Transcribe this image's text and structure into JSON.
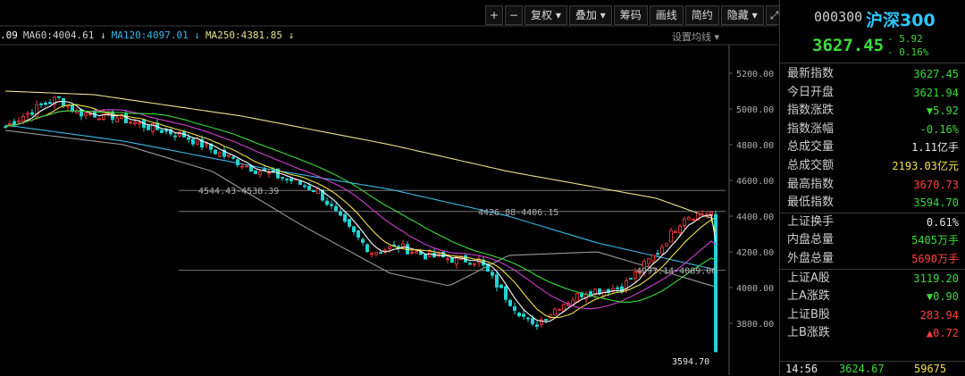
{
  "toolbar": {
    "plus": "+",
    "minus": "−",
    "fuquan": "复权",
    "diejia": "叠加",
    "chouma": "筹码",
    "huaxian": "画线",
    "jianyue": "简约",
    "yincang": "隐藏",
    "expand": "⤢"
  },
  "ma_legend": [
    {
      "text": ".09",
      "color": "#ffffff"
    },
    {
      "text": "MA60:4004.61 ↓",
      "color": "#cfcfcf"
    },
    {
      "text": "MA120:4097.01 ↓",
      "color": "#3ab8e8"
    },
    {
      "text": "MA250:4381.85 ↓",
      "color": "#e8e08a"
    }
  ],
  "settings_label": "设置均线 ▾",
  "chart_data": {
    "type": "candlestick",
    "y_ticks": [
      "5200.00",
      "5000.00",
      "4800.00",
      "4600.00",
      "4400.00",
      "4200.00",
      "4000.00",
      "3800.00"
    ],
    "y_tick_values": [
      5200,
      5000,
      4800,
      4600,
      4400,
      4200,
      4000,
      3800
    ],
    "ylim": [
      3550,
      5350
    ],
    "n_bars": 160,
    "close_path": [
      [
        0,
        4900
      ],
      [
        8,
        5020
      ],
      [
        12,
        5060
      ],
      [
        16,
        4980
      ],
      [
        24,
        4960
      ],
      [
        32,
        4900
      ],
      [
        40,
        4850
      ],
      [
        48,
        4750
      ],
      [
        56,
        4660
      ],
      [
        64,
        4600
      ],
      [
        70,
        4540
      ],
      [
        76,
        4350
      ],
      [
        82,
        4200
      ],
      [
        88,
        4230
      ],
      [
        94,
        4180
      ],
      [
        100,
        4160
      ],
      [
        106,
        4150
      ],
      [
        112,
        3950
      ],
      [
        118,
        3780
      ],
      [
        124,
        3900
      ],
      [
        130,
        3980
      ],
      [
        138,
        4000
      ],
      [
        146,
        4200
      ],
      [
        152,
        4400
      ],
      [
        158,
        4420
      ]
    ],
    "close_path_2": [
      [
        0,
        4420
      ],
      [
        6,
        4330
      ],
      [
        12,
        4260
      ],
      [
        18,
        4220
      ],
      [
        24,
        4170
      ],
      [
        30,
        4160
      ],
      [
        36,
        4120
      ],
      [
        42,
        4060
      ],
      [
        48,
        3980
      ],
      [
        54,
        3900
      ],
      [
        60,
        3840
      ],
      [
        66,
        3780
      ],
      [
        72,
        3710
      ],
      [
        78,
        3620
      ]
    ],
    "ma250": [
      [
        0,
        5100
      ],
      [
        30,
        5080
      ],
      [
        80,
        4960
      ],
      [
        130,
        4800
      ],
      [
        170,
        4650
      ],
      [
        220,
        4500
      ],
      [
        240,
        4380
      ]
    ],
    "ma120": [
      [
        0,
        4910
      ],
      [
        40,
        4820
      ],
      [
        90,
        4660
      ],
      [
        130,
        4550
      ],
      [
        170,
        4400
      ],
      [
        200,
        4250
      ],
      [
        240,
        4100
      ]
    ],
    "ma60": [
      [
        0,
        4880
      ],
      [
        40,
        4800
      ],
      [
        70,
        4650
      ],
      [
        100,
        4350
      ],
      [
        130,
        4080
      ],
      [
        150,
        4010
      ],
      [
        170,
        4180
      ],
      [
        200,
        4200
      ],
      [
        240,
        4004
      ]
    ],
    "annotations": [
      {
        "text": "4544.43-4538.39",
        "value": 4544
      },
      {
        "text": "4426.88-4406.15",
        "value": 4426
      },
      {
        "text": "4097.14-4089.06",
        "value": 4097
      },
      {
        "text": "3594.70",
        "value": 3595
      }
    ],
    "hlines": [
      4544,
      4426,
      4097
    ]
  },
  "panel": {
    "code": "000300",
    "name": "沪深300",
    "price": "3627.45",
    "change": "- 5.92",
    "change_pct": "- 0.16%",
    "rows": [
      {
        "label": "最新指数",
        "value": "3627.45",
        "color": "#3bdc3b"
      },
      {
        "label": "今日开盘",
        "value": "3621.94",
        "color": "#3bdc3b"
      },
      {
        "label": "指数涨跌",
        "value": "▼5.92",
        "color": "#3bdc3b"
      },
      {
        "label": "指数涨幅",
        "value": "-0.16%",
        "color": "#3bdc3b"
      },
      {
        "label": "总成交量",
        "value": "1.11亿手",
        "color": "#e6e6e6"
      },
      {
        "label": "总成交额",
        "value": "2193.03亿元",
        "color": "#f2e14c"
      },
      {
        "label": "最高指数",
        "value": "3670.73",
        "color": "#ff4040"
      },
      {
        "label": "最低指数",
        "value": "3594.70",
        "color": "#3bdc3b"
      },
      {
        "label": "上证换手",
        "value": "0.61%",
        "color": "#e6e6e6",
        "sep": true
      },
      {
        "label": "内盘总量",
        "value": "5405万手",
        "color": "#3bdc3b"
      },
      {
        "label": "外盘总量",
        "value": "5690万手",
        "color": "#ff4040"
      },
      {
        "label": "上证A股",
        "value": "3119.20",
        "color": "#3bdc3b",
        "sep": true
      },
      {
        "label": "上A涨跌",
        "value": "▼0.90",
        "color": "#3bdc3b"
      },
      {
        "label": "上证B股",
        "value": "283.94",
        "color": "#ff4040"
      },
      {
        "label": "上B涨跌",
        "value": "▲0.72",
        "color": "#ff4040"
      }
    ],
    "footer": {
      "time": "14:56",
      "price": "3624.67",
      "volume": "59675"
    }
  }
}
